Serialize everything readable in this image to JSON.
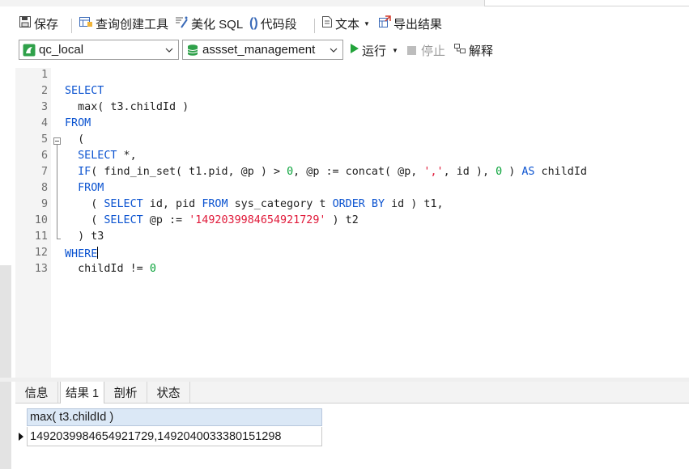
{
  "toolbar": {
    "save": "保存",
    "query_builder": "查询创建工具",
    "beautify": "美化 SQL",
    "snippet": "代码段",
    "text": "文本",
    "export": "导出结果"
  },
  "connection": {
    "server": "qc_local",
    "database": "assset_management",
    "run": "运行",
    "stop": "停止",
    "explain": "解释"
  },
  "editor": {
    "line_numbers": [
      "1",
      "2",
      "3",
      "4",
      "5",
      "6",
      "7",
      "8",
      "9",
      "10",
      "11",
      "12",
      "13"
    ],
    "lines": [
      [],
      [
        {
          "t": "SELECT",
          "c": "kw"
        }
      ],
      [
        {
          "t": "  max( t3.childId )",
          "c": ""
        }
      ],
      [
        {
          "t": "FROM",
          "c": "kw"
        }
      ],
      [
        {
          "t": "  (",
          "c": ""
        }
      ],
      [
        {
          "t": "  ",
          "c": ""
        },
        {
          "t": "SELECT",
          "c": "kw"
        },
        {
          "t": " *,",
          "c": ""
        }
      ],
      [
        {
          "t": "  ",
          "c": ""
        },
        {
          "t": "IF",
          "c": "kw"
        },
        {
          "t": "( find_in_set( t1.pid, @p ) > ",
          "c": ""
        },
        {
          "t": "0",
          "c": "num"
        },
        {
          "t": ", @p := concat( @p, ",
          "c": ""
        },
        {
          "t": "','",
          "c": "str"
        },
        {
          "t": ", id ), ",
          "c": ""
        },
        {
          "t": "0",
          "c": "num"
        },
        {
          "t": " ) ",
          "c": ""
        },
        {
          "t": "AS",
          "c": "kw"
        },
        {
          "t": " childId",
          "c": ""
        }
      ],
      [
        {
          "t": "  ",
          "c": ""
        },
        {
          "t": "FROM",
          "c": "kw"
        }
      ],
      [
        {
          "t": "    ( ",
          "c": ""
        },
        {
          "t": "SELECT",
          "c": "kw"
        },
        {
          "t": " id, pid ",
          "c": ""
        },
        {
          "t": "FROM",
          "c": "kw"
        },
        {
          "t": " sys_category t ",
          "c": ""
        },
        {
          "t": "ORDER BY",
          "c": "kw"
        },
        {
          "t": " id ) t1,",
          "c": ""
        }
      ],
      [
        {
          "t": "    ( ",
          "c": ""
        },
        {
          "t": "SELECT",
          "c": "kw"
        },
        {
          "t": " @p := ",
          "c": ""
        },
        {
          "t": "'1492039984654921729'",
          "c": "str"
        },
        {
          "t": " ) t2",
          "c": ""
        }
      ],
      [
        {
          "t": "  ) t3",
          "c": ""
        }
      ],
      [
        {
          "t": "WHERE",
          "c": "kw"
        }
      ],
      [
        {
          "t": "  childId != ",
          "c": ""
        },
        {
          "t": "0",
          "c": "num"
        }
      ]
    ]
  },
  "result_tabs": [
    "信息",
    "结果 1",
    "剖析",
    "状态"
  ],
  "result": {
    "column": "max( t3.childId )",
    "rows": [
      "1492039984654921729,1492040033380151298"
    ]
  },
  "colors": {
    "keyword": "#0b53d0",
    "number": "#0aa33a",
    "string": "#e01a3a",
    "run_green": "#22a33a",
    "header_blue": "#dbe8f6"
  }
}
